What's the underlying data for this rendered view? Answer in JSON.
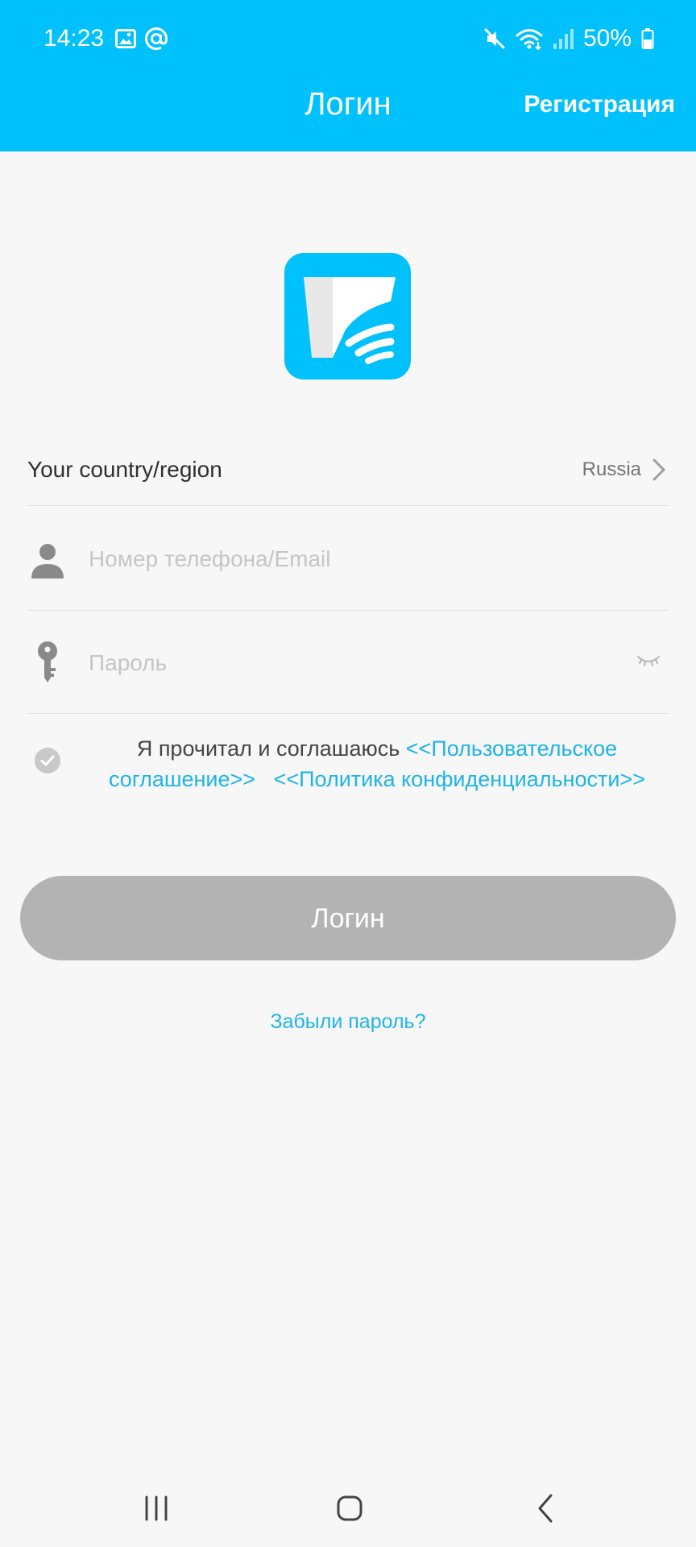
{
  "status_bar": {
    "time": "14:23",
    "battery": "50%",
    "left_icons": [
      "image-icon",
      "at-sign-icon"
    ],
    "right_icons": [
      "mute-icon",
      "wifi-icon",
      "signal-icon",
      "battery-icon"
    ]
  },
  "header": {
    "title": "Логин",
    "action": "Регистрация"
  },
  "country": {
    "label": "Your country/region",
    "value": "Russia"
  },
  "phone_field": {
    "placeholder": "Номер телефона/Email",
    "value": ""
  },
  "password_field": {
    "placeholder": "Пароль",
    "value": ""
  },
  "agreement": {
    "text": "Я прочитал и соглашаюсь ",
    "user_agreement": "<<Пользовательское соглашение>>",
    "privacy_policy": "<<Политика конфиденциальности>>"
  },
  "login_button": "Логин",
  "forgot_password": "Забыли пароль?",
  "colors": {
    "header": "#00c1fb",
    "link": "#1eb4e8",
    "button_disabled": "#b3b3b3",
    "background": "#f7f7f7"
  }
}
